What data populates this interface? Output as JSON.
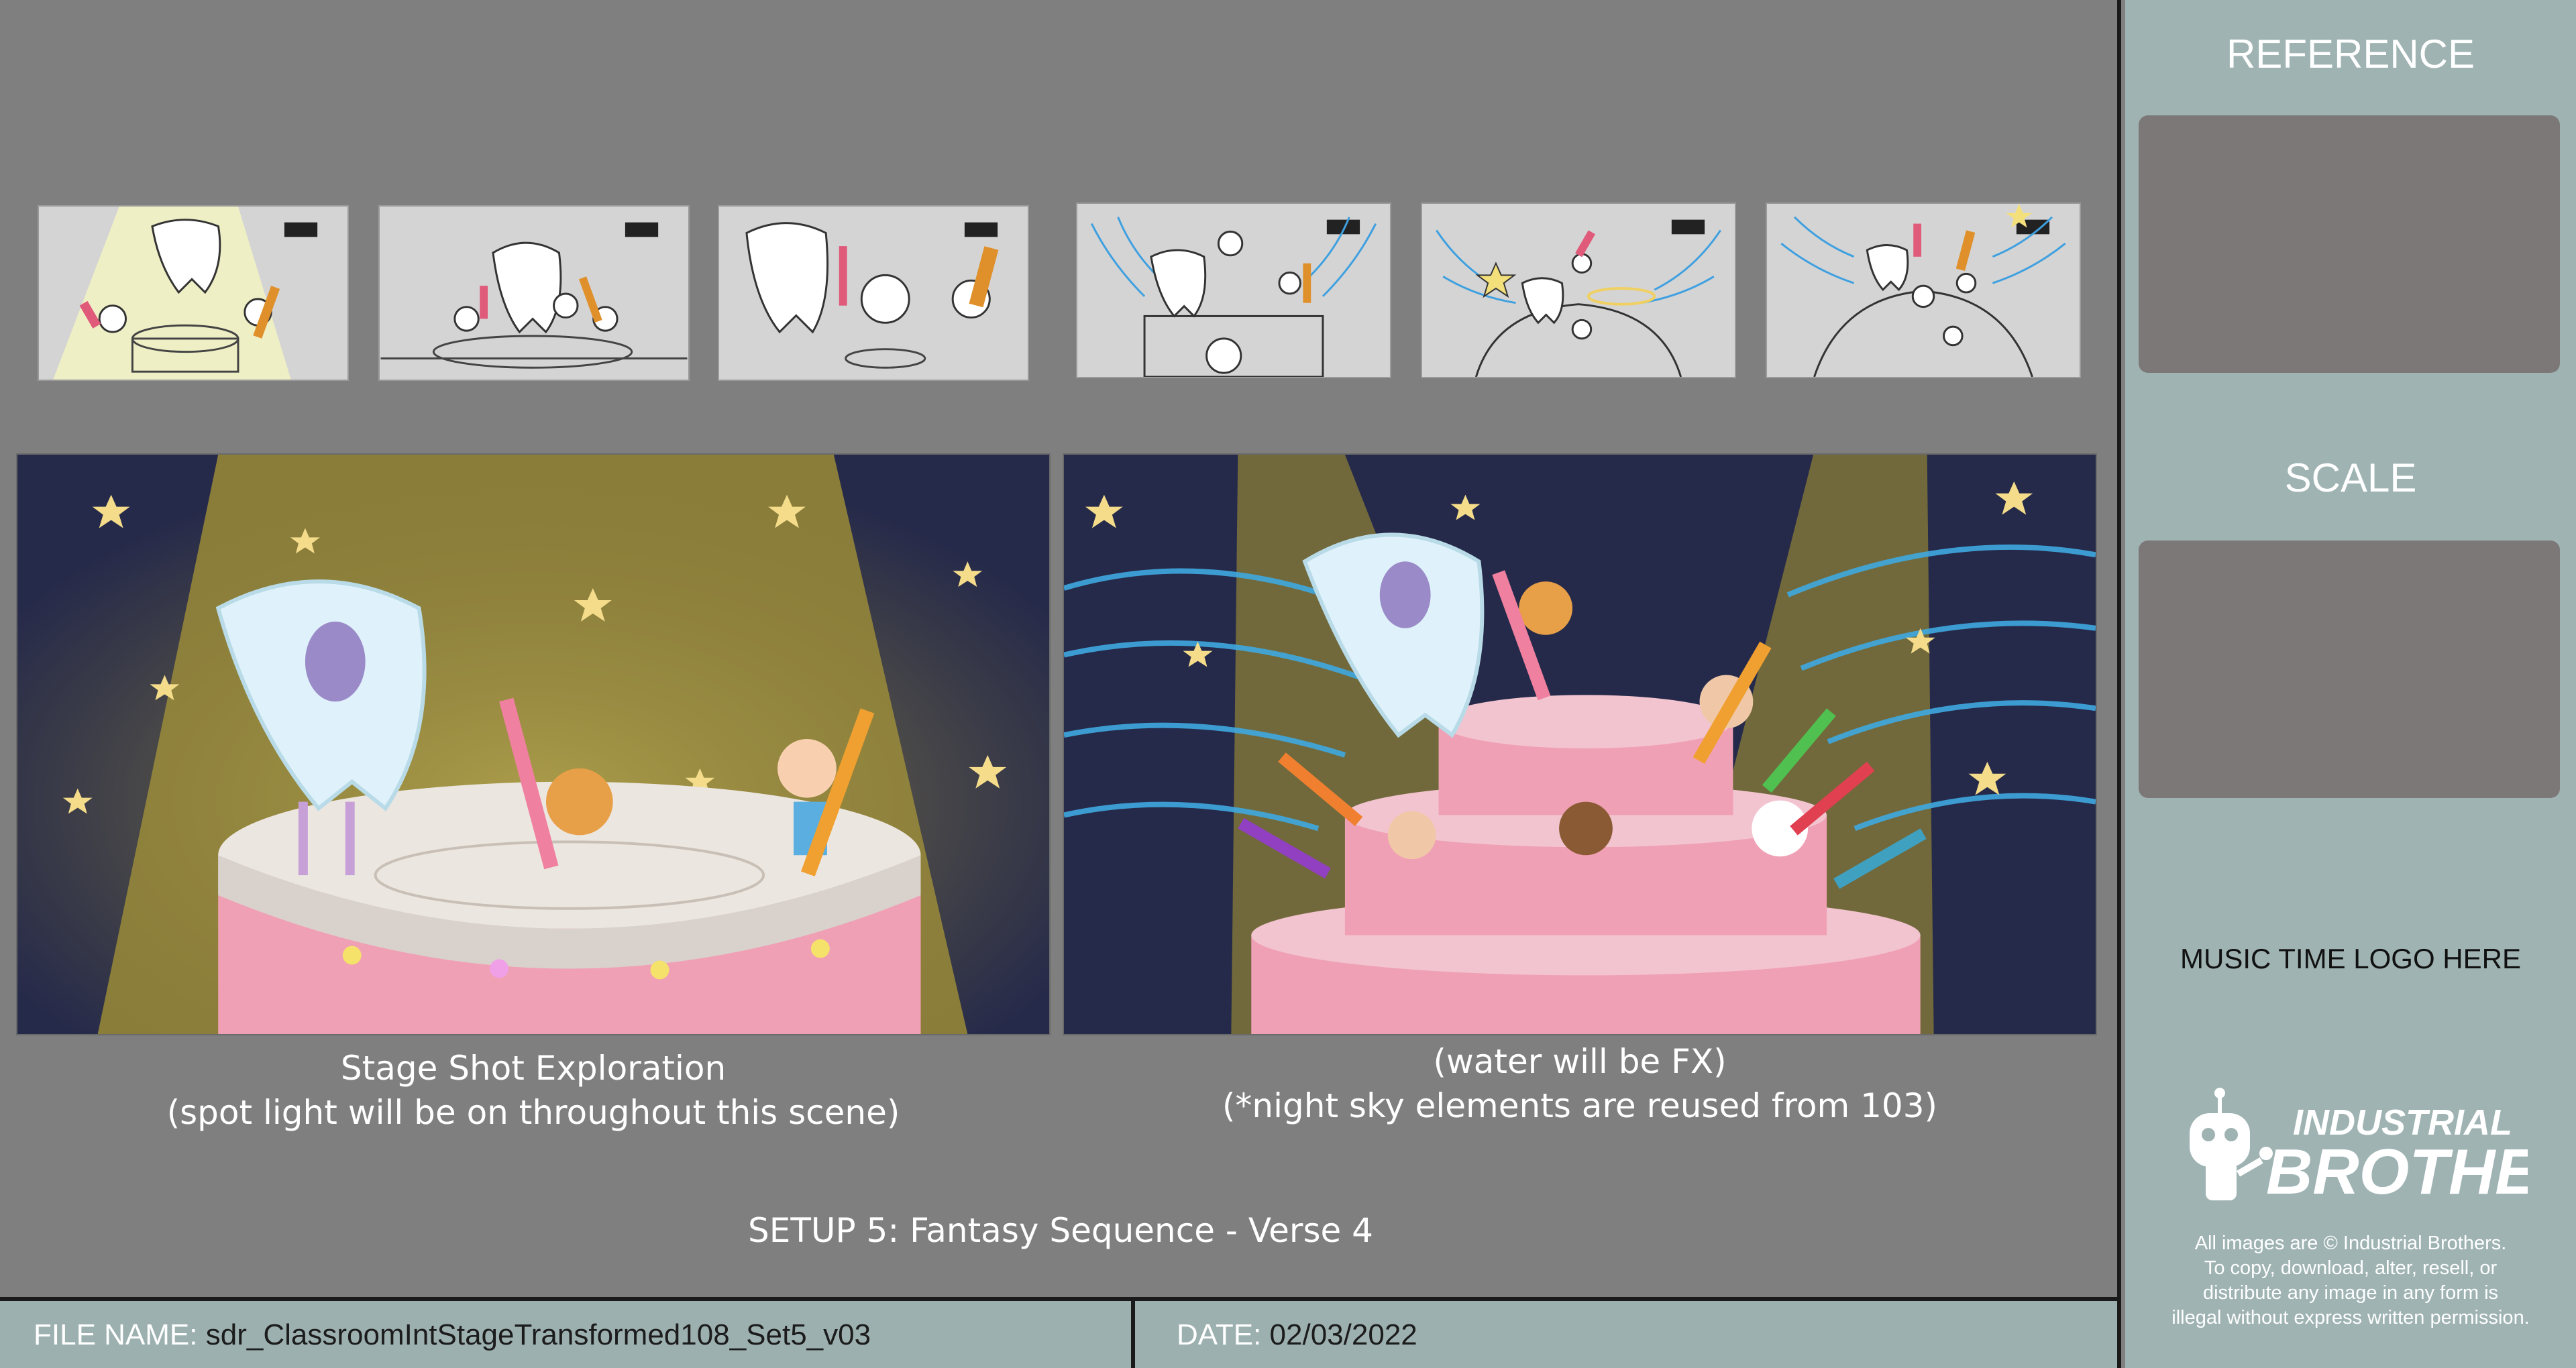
{
  "sidebar": {
    "reference_label": "REFERENCE",
    "scale_label": "SCALE",
    "music_logo_text": "MUSIC TIME LOGO HERE",
    "logo_line1": "INDUSTRIAL",
    "logo_line2": "BROTHERS",
    "copyright_lines": [
      "All images are © Industrial Brothers.",
      "To copy, download, alter, resell, or",
      "distribute any image in any form is",
      "illegal without express written permission."
    ]
  },
  "captions": {
    "left_line1": "Stage Shot  Exploration",
    "left_line2": "(spot light will be on throughout this scene)",
    "right_line1": "(water will be FX)",
    "right_line2": "(*night sky elements are reused from 103)"
  },
  "setup_title": "SETUP 5: Fantasy Sequence - Verse 4",
  "footer": {
    "file_label": "FILE NAME:",
    "file_value": "sdr_ClassroomIntStageTransformed108_Set5_v03",
    "date_label": "DATE:",
    "date_value": "02/03/2022"
  },
  "colors": {
    "night_sky": "#262a4a",
    "spotlight": "#8a7d3a",
    "cake_pink": "#f0a0b4",
    "cake_top": "#ece6e0",
    "tooth": "#dff2fb",
    "star": "#f4dc8a",
    "water_fx": "#3fa9e0"
  }
}
